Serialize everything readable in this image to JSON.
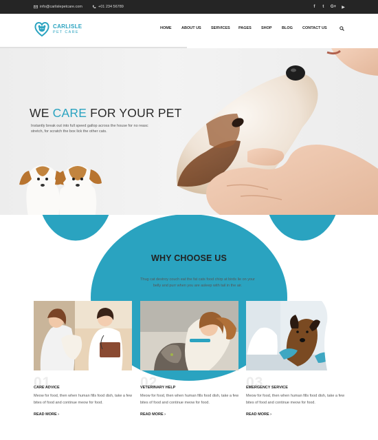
{
  "topbar": {
    "email": "info@carlislepetcare.com",
    "phone": "+01 234 56789",
    "social": [
      {
        "icon": "facebook-icon",
        "glyph": "f"
      },
      {
        "icon": "twitter-icon",
        "glyph": "t"
      },
      {
        "icon": "google-plus-icon",
        "glyph": "G+"
      },
      {
        "icon": "youtube-icon",
        "glyph": "▶"
      }
    ]
  },
  "logo": {
    "name": "CARLISLE",
    "tagline": "PET CARE"
  },
  "nav": {
    "items": [
      "HOME",
      "ABOUT US",
      "SERVICES",
      "PAGES",
      "SHOP",
      "BLOG",
      "CONTACT US"
    ],
    "active": "HOME"
  },
  "hero": {
    "title_before": "WE ",
    "title_accent": "CARE",
    "title_after": " FOR YOUR PET",
    "text": "Instantly break out into full speed gallop across the house for no reasc stretch, for scratch the box lick the other cats."
  },
  "why": {
    "title": "WHY CHOOSE US",
    "text": "Thug cat destroy couch eat the fat cats food chirp at birds lie on your belly and purr when you are asleep with tail in the air."
  },
  "cards": [
    {
      "num": "01",
      "title": "CARE ADVICE",
      "text": "Meow for food, then when human fills food dish, take a few bites of food and continue meow for food.",
      "link": "READ MORE ›"
    },
    {
      "num": "02",
      "title": "VETERINARY HELP",
      "text": "Meow for food, then when human fills food dish, take a few bites of food and continue meow for food.",
      "link": "READ MORE ›"
    },
    {
      "num": "03",
      "title": "EMERGENCY SERVICE",
      "text": "Meow for food, then when human fills food dish, take a few bites of food and continue meow for food.",
      "link": "READ MORE ›"
    }
  ],
  "colors": {
    "accent": "#2aa3c0",
    "topbar": "#252525"
  }
}
